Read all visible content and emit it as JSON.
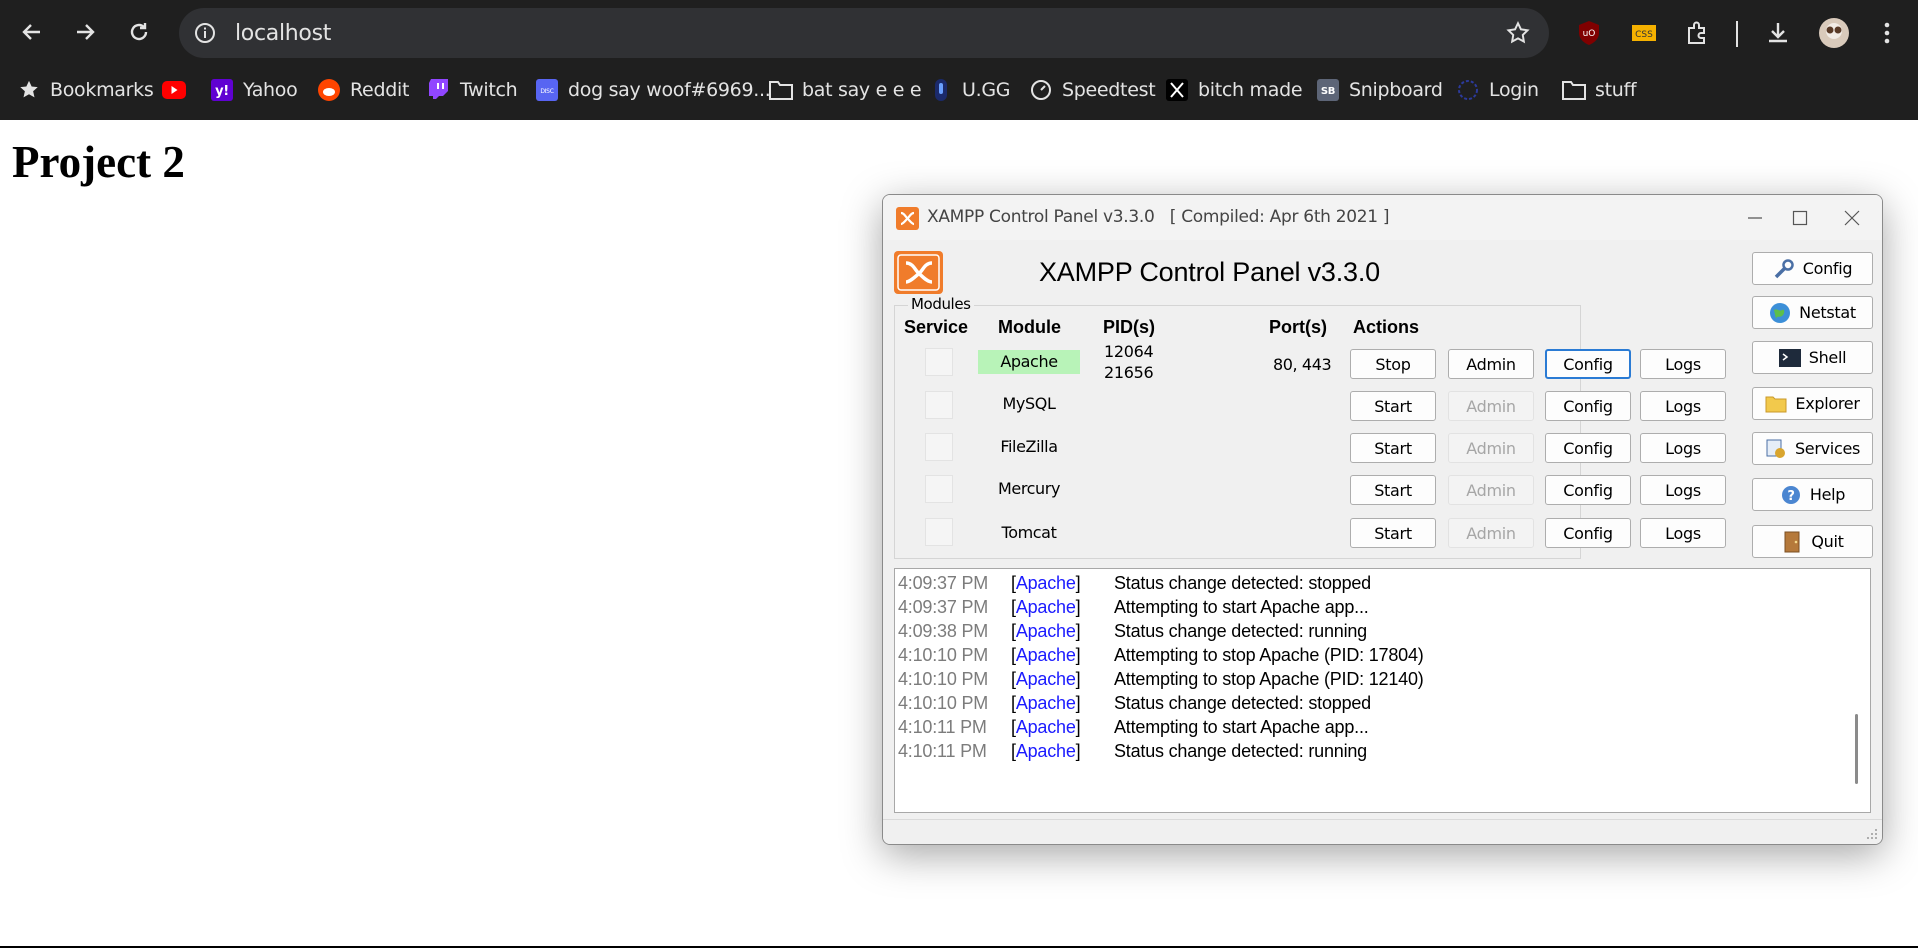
{
  "browser": {
    "url": "localhost",
    "bookmarks": [
      {
        "label": "Bookmarks",
        "icon": "star-icon"
      },
      {
        "label": "",
        "icon": "youtube-icon"
      },
      {
        "label": "Yahoo",
        "icon": "yahoo-icon"
      },
      {
        "label": "Reddit",
        "icon": "reddit-icon"
      },
      {
        "label": "Twitch",
        "icon": "twitch-icon"
      },
      {
        "label": "dog say woof#6969...",
        "icon": "discord-icon"
      },
      {
        "label": "bat say e e e",
        "icon": "folder-icon"
      },
      {
        "label": "U.GG",
        "icon": "ugg-icon"
      },
      {
        "label": "Speedtest",
        "icon": "speedtest-icon"
      },
      {
        "label": "bitch made",
        "icon": "x-icon"
      },
      {
        "label": "Snipboard",
        "icon": "snipboard-icon"
      },
      {
        "label": "Login",
        "icon": "login-icon"
      },
      {
        "label": "stuff",
        "icon": "folder-icon"
      }
    ]
  },
  "page": {
    "title": "Project 2"
  },
  "xampp": {
    "window_title": "XAMPP Control Panel v3.3.0   [ Compiled: Apr 6th 2021 ]",
    "heading": "XAMPP Control Panel v3.3.0",
    "modules_label": "Modules",
    "columns": {
      "service": "Service",
      "module": "Module",
      "pids": "PID(s)",
      "ports": "Port(s)",
      "actions": "Actions"
    },
    "modules": [
      {
        "name": "Apache",
        "pid1": "12064",
        "pid2": "21656",
        "ports": "80, 443",
        "start_stop": "Stop",
        "admin": "Admin",
        "config": "Config",
        "logs": "Logs",
        "running": true
      },
      {
        "name": "MySQL",
        "pid1": "",
        "pid2": "",
        "ports": "",
        "start_stop": "Start",
        "admin": "Admin",
        "config": "Config",
        "logs": "Logs",
        "running": false
      },
      {
        "name": "FileZilla",
        "pid1": "",
        "pid2": "",
        "ports": "",
        "start_stop": "Start",
        "admin": "Admin",
        "config": "Config",
        "logs": "Logs",
        "running": false
      },
      {
        "name": "Mercury",
        "pid1": "",
        "pid2": "",
        "ports": "",
        "start_stop": "Start",
        "admin": "Admin",
        "config": "Config",
        "logs": "Logs",
        "running": false
      },
      {
        "name": "Tomcat",
        "pid1": "",
        "pid2": "",
        "ports": "",
        "start_stop": "Start",
        "admin": "Admin",
        "config": "Config",
        "logs": "Logs",
        "running": false
      }
    ],
    "side_buttons": [
      {
        "label": "Config",
        "icon": "wrench-icon"
      },
      {
        "label": "Netstat",
        "icon": "globe-icon"
      },
      {
        "label": "Shell",
        "icon": "terminal-icon"
      },
      {
        "label": "Explorer",
        "icon": "folder-icon"
      },
      {
        "label": "Services",
        "icon": "services-icon"
      },
      {
        "label": "Help",
        "icon": "help-icon"
      },
      {
        "label": "Quit",
        "icon": "door-icon"
      }
    ],
    "log": [
      {
        "time": "4:09:37 PM",
        "module": "Apache",
        "message": "Status change detected: stopped"
      },
      {
        "time": "4:09:37 PM",
        "module": "Apache",
        "message": "Attempting to start Apache app..."
      },
      {
        "time": "4:09:38 PM",
        "module": "Apache",
        "message": "Status change detected: running"
      },
      {
        "time": "4:10:10 PM",
        "module": "Apache",
        "message": "Attempting to stop Apache (PID: 17804)"
      },
      {
        "time": "4:10:10 PM",
        "module": "Apache",
        "message": "Attempting to stop Apache (PID: 12140)"
      },
      {
        "time": "4:10:10 PM",
        "module": "Apache",
        "message": "Status change detected: stopped"
      },
      {
        "time": "4:10:11 PM",
        "module": "Apache",
        "message": "Attempting to start Apache app..."
      },
      {
        "time": "4:10:11 PM",
        "module": "Apache",
        "message": "Status change detected: running"
      }
    ]
  },
  "colors": {
    "chrome_bg": "#1f1f1f",
    "omnibox_bg": "#303134",
    "xampp_orange": "#f07c2b",
    "running_green": "#b8f3b8",
    "log_module_blue": "#1b1bff"
  }
}
